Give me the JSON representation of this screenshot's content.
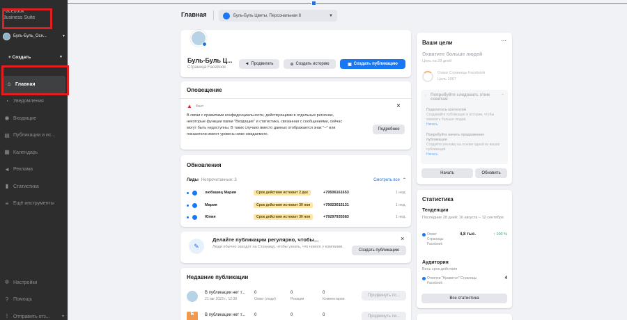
{
  "sidebar": {
    "app_title_line1": "Facebook",
    "app_title_line2": "Business Suite",
    "account_name": "Буль-Буль_Осн...",
    "create_label": "+ Создать",
    "nav": [
      {
        "label": "Главная",
        "icon": "home-icon",
        "glyph": "⌂"
      },
      {
        "label": "Уведомления",
        "icon": "bell-icon",
        "glyph": "◔"
      },
      {
        "label": "Входящие",
        "icon": "inbox-icon",
        "glyph": "◉"
      },
      {
        "label": "Публикации и ис...",
        "icon": "posts-icon",
        "glyph": "▤"
      },
      {
        "label": "Календарь",
        "icon": "calendar-icon",
        "glyph": "▦"
      },
      {
        "label": "Реклама",
        "icon": "megaphone-icon",
        "glyph": "◄"
      },
      {
        "label": "Статистика",
        "icon": "stats-icon",
        "glyph": "▮"
      },
      {
        "label": "Ещё инструменты",
        "icon": "menu-icon",
        "glyph": "≡"
      }
    ],
    "bottom": [
      {
        "label": "Настройки",
        "icon": "gear-icon",
        "glyph": "✲"
      },
      {
        "label": "Помощь",
        "icon": "help-icon",
        "glyph": "?"
      },
      {
        "label": "Отправить отз...",
        "icon": "feedback-icon",
        "glyph": "!"
      }
    ]
  },
  "header": {
    "title": "Главная",
    "page_selector": "Буль-Буль Цветы, Персональная 8"
  },
  "profile": {
    "name": "Буль-Буль Ц...",
    "subtitle": "Страница Facebook",
    "promote": "Продвигать",
    "create_story": "Создать историю",
    "create_post": "Создать публикацию"
  },
  "alert": {
    "section_title": "Оповещение",
    "label": "Факт",
    "text": "В связи с правилами конфиденциальности, действующими в отдельных регионах, некоторые функции папки \"Входящие\" и статистика, связанная с сообщениями, сейчас могут быть недоступны. В таких случаях вместо данных отображается знак \"--\" или показатели имеют уровень ниже ожидаемого.",
    "button": "Подробнее"
  },
  "updates": {
    "title": "Обновления",
    "leads_label": "Лиды",
    "leads_sub": "Непрочитанные: 3",
    "see_all": "Смотреть все",
    "rows": [
      {
        "name": "любашиц Мария",
        "badge": "Срок действия истекает 2 дек",
        "phone": "+79506161653",
        "time": "1 нед."
      },
      {
        "name": "Мария",
        "badge": "Срок действия истекает 30 ноя",
        "phone": "+79023015131",
        "time": "1 нед."
      },
      {
        "name": "Юлия",
        "badge": "Срок действия истекает 30 ноя",
        "phone": "+79297935583",
        "time": "1 нед."
      }
    ]
  },
  "regular": {
    "title": "Делайте публикации регулярно, чтобы...",
    "text": "Люди обычно заходят на Страницу, чтобы узнать, что нового у компании.",
    "button": "Создать публикацию"
  },
  "recent": {
    "title": "Недавние публикации",
    "rows": [
      {
        "text": "В публикации нет т...",
        "date": "21 авг 2023 г., 12:38",
        "reach": "0",
        "reach_label": "Охват (люди)",
        "reactions": "0",
        "reactions_label": "Реакции",
        "comments": "0",
        "comments_label": "Комментарии",
        "button": "Продвинуть пс..."
      },
      {
        "text": "В публикации нет т...",
        "date": "",
        "reach": "0",
        "reach_label": "",
        "reactions": "0",
        "reactions_label": "",
        "comments": "0",
        "comments_label": "",
        "button": "Продвинуть пе..."
      }
    ]
  },
  "goals": {
    "title": "Ваши цели",
    "goal_title": "Охватите больше людей",
    "goal_sub": "Цель на 28 дней",
    "metric_line1": "Охват Страницы Facebook",
    "metric_line2": "Цель 1067",
    "tips_title": "Попробуйте следовать этим советам",
    "tips": [
      {
        "title": "Поделитесь контентом",
        "text": "Создавайте публикации и истории, чтобы охватить больше людей.",
        "link": "Начать"
      },
      {
        "title": "Попробуйте начать продвижение публикации",
        "text": "Создайте рекламу на основе одной из ваших публикаций.",
        "link": "Начать"
      }
    ],
    "start_button": "Начать",
    "refresh_button": "Обновить"
  },
  "stats": {
    "title": "Статистика",
    "trends_title": "Тенденции",
    "trends_sub": "Последние 28 дней: 16 августа – 12 сентября",
    "reach_label": "Охват Страницы Facebook",
    "reach_value": "4,8 тыс.",
    "reach_change": "↑ 100 %",
    "audience_title": "Аудитория",
    "audience_sub": "Весь срок действия",
    "likes_label": "Отметки \"Нравится\" Страницы Facebook",
    "likes_value": "4",
    "all_button": "Все статистика"
  }
}
